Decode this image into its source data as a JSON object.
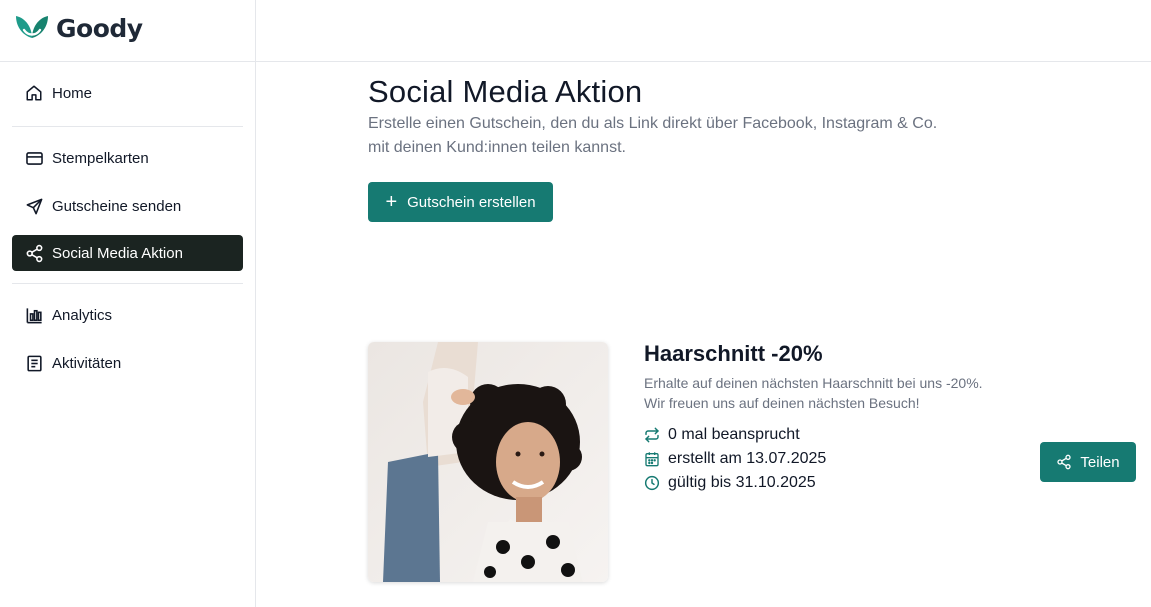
{
  "app": {
    "name": "Goody",
    "brand_color": "#167a72"
  },
  "sidebar": {
    "items": [
      {
        "label": "Home",
        "icon": "home-icon"
      },
      {
        "label": "Stempelkarten",
        "icon": "credit-card-icon"
      },
      {
        "label": "Gutscheine senden",
        "icon": "send-icon"
      },
      {
        "label": "Social Media Aktion",
        "icon": "share-icon",
        "active": true
      },
      {
        "label": "Analytics",
        "icon": "bar-chart-icon"
      },
      {
        "label": "Aktivitäten",
        "icon": "list-icon"
      }
    ]
  },
  "main": {
    "title": "Social Media Aktion",
    "subtitle": "Erstelle einen Gutschein, den du als Link direkt über Facebook, Instagram & Co. mit deinen Kund:innen teilen kannst.",
    "create_button": "Gutschein erstellen"
  },
  "voucher": {
    "title": "Haarschnitt -20%",
    "description_line1": "Erhalte auf deinen nächsten Haarschnitt bei uns -20%.",
    "description_line2": "Wir freuen uns auf deinen nächsten Besuch!",
    "claimed": "0 mal beansprucht",
    "created": "erstellt am 13.07.2025",
    "valid": "gültig bis 31.10.2025",
    "share_button": "Teilen"
  }
}
